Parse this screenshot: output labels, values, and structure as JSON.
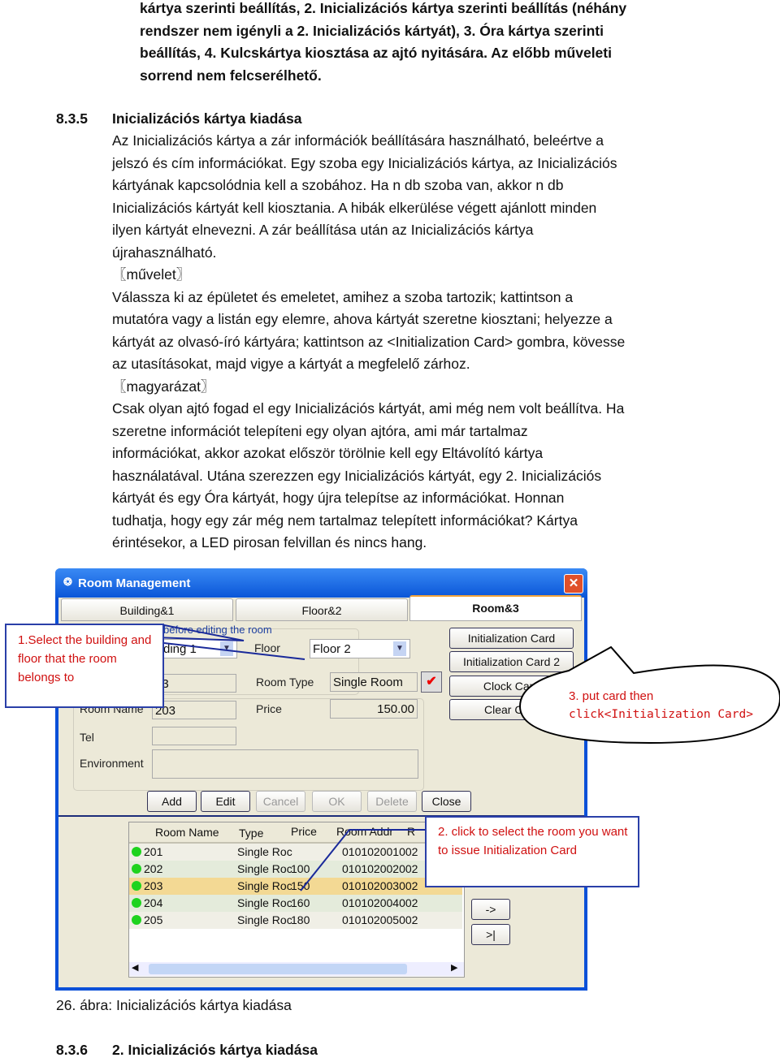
{
  "intro_lines": [
    "kártya szerinti beállítás, 2. Inicializációs kártya szerinti beállítás (néhány",
    "rendszer nem igényli a 2. Inicializációs kártyát), 3. Óra kártya szerinti",
    "beállítás, 4. Kulcskártya kiosztása az ajtó nyitására. Az előbb műveleti",
    "sorrend nem felcserélhető."
  ],
  "section": {
    "number": "8.3.5",
    "title": "Inicializációs kártya kiadása"
  },
  "body_lines": [
    "Az Inicializációs kártya a zár információk beállítására használható, beleértve a",
    "jelszó és cím információkat. Egy szoba egy Inicializációs kártya, az Inicializációs",
    "kártyának kapcsolódnia kell a szobához. Ha n db szoba van, akkor n db",
    "Inicializációs kártyát kell kiosztania. A hibák elkerülése végett ajánlott minden",
    "ilyen kártyát elnevezni. A zár beállítása után az Inicializációs kártya",
    "újrahasználható.",
    "〖művelet〗",
    "Válassza ki az épületet és emeletet, amihez a szoba tartozik; kattintson a",
    "mutatóra vagy a listán egy elemre, ahova kártyát szeretne kiosztani; helyezze a",
    "kártyát az olvasó-író kártyára; kattintson az <Initialization Card> gombra, kövesse",
    "az utasításokat, majd vigye a kártyát a megfelelő zárhoz.",
    "〖magyarázat〗",
    "Csak olyan ajtó fogad el egy Inicializációs kártyát, ami még nem volt beállítva. Ha",
    "szeretne információt telepíteni egy olyan ajtóra, ami már tartalmaz",
    "információkat, akkor azokat először törölnie kell egy Eltávolító kártya",
    "használatával. Utána szerezzen egy Inicializációs kártyát, egy 2. Inicializációs",
    "kártyát és egy Óra kártyát, hogy újra telepítse az információkat. Honnan",
    "tudhatja, hogy egy zár még nem tartalmaz telepített információkat? Kártya",
    "érintésekor, a LED pirosan felvillan és nincs hang."
  ],
  "window": {
    "title": "Room Management",
    "tabs": [
      "Building&1",
      "Floor&2",
      "Room&3"
    ],
    "group_label": "before editing the room",
    "building_value": "ding 1",
    "floor_label": "Floor",
    "floor_value": "Floor 2",
    "room_no_value": "03",
    "room_type_label": "Room Type",
    "room_type_value": "Single Room",
    "room_name_label": "Room Name",
    "room_name_value": "203",
    "price_label": "Price",
    "price_value": "150.00",
    "tel_label": "Tel",
    "env_label": "Environment",
    "side_buttons": [
      "Initialization Card",
      "Initialization Card 2",
      "Clock Card",
      "Clear C"
    ],
    "buttons": [
      "Add",
      "Edit",
      "Cancel",
      "OK",
      "Delete",
      "Close"
    ],
    "columns": [
      "Room Name",
      "Type",
      "Price",
      "Room Addr",
      "R"
    ],
    "rows": [
      [
        "201",
        "Single Roc",
        "",
        "010102001002"
      ],
      [
        "202",
        "Single Roc",
        "100",
        "010102002002"
      ],
      [
        "203",
        "Single Roc",
        "150",
        "010102003002"
      ],
      [
        "204",
        "Single Roc",
        "160",
        "010102004002"
      ],
      [
        "205",
        "Single Roc",
        "180",
        "010102005002"
      ]
    ],
    "selected_row": 2,
    "nav_buttons": [
      "->",
      ">|"
    ]
  },
  "callouts": {
    "c1": "1.Select the building and floor that the room belongs to",
    "c2": "2. click to select the room you want to issue Initialization Card",
    "c3_line1": "3. put card then",
    "c3_line2": "click<Initialization Card>"
  },
  "caption": "26. ábra: Inicializációs kártya kiadása",
  "next_section": {
    "number": "8.3.6",
    "title": "2. Inicializációs kártya kiadása"
  }
}
